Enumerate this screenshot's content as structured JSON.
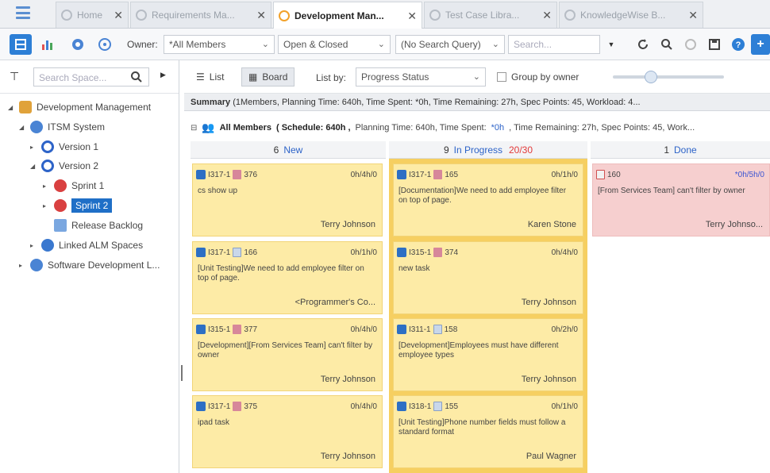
{
  "tabs": [
    {
      "label": "Home",
      "active": false
    },
    {
      "label": "Requirements Ma...",
      "active": false
    },
    {
      "label": "Development Man...",
      "active": true
    },
    {
      "label": "Test Case Libra...",
      "active": false
    },
    {
      "label": "KnowledgeWise B...",
      "active": false
    }
  ],
  "toolbar": {
    "owner_label": "Owner:",
    "owner_value": "*All Members",
    "status_value": "Open & Closed",
    "query_value": "(No Search Query)",
    "search_placeholder": "Search..."
  },
  "left": {
    "search_placeholder": "Search Space...",
    "tree": [
      {
        "label": "Development Management",
        "level": 0,
        "expanded": true,
        "icon": "db-icon",
        "color": "#e0a23a"
      },
      {
        "label": "ITSM System",
        "level": 1,
        "expanded": true,
        "icon": "project-icon",
        "color": "#4a84d4"
      },
      {
        "label": "Version 1",
        "level": 2,
        "expanded": false,
        "icon": "version-icon",
        "color": "#2d63c8"
      },
      {
        "label": "Version 2",
        "level": 2,
        "expanded": true,
        "icon": "version-icon",
        "color": "#2d63c8"
      },
      {
        "label": "Sprint 1",
        "level": 3,
        "expanded": false,
        "icon": "sprint-icon",
        "color": "#d94040"
      },
      {
        "label": "Sprint 2",
        "level": 3,
        "expanded": false,
        "icon": "sprint-icon",
        "color": "#d94040",
        "selected": true
      },
      {
        "label": "Release Backlog",
        "level": 2,
        "expanded": null,
        "icon": "backlog-icon",
        "color": "#7aa7e0"
      },
      {
        "label": "Linked ALM Spaces",
        "level": 1,
        "expanded": false,
        "icon": "link-icon",
        "color": "#3a78cf"
      },
      {
        "label": "Software Development L...",
        "level": 0,
        "expanded": false,
        "icon": "project-icon",
        "color": "#4a84d4"
      }
    ]
  },
  "view": {
    "list_label": "List",
    "board_label": "Board",
    "list_by_label": "List by:",
    "list_by_value": "Progress Status",
    "group_label": "Group by owner"
  },
  "summary": {
    "label": "Summary",
    "text": "(1Members, Planning Time: 640h, Time Spent: *0h, Time Remaining: 27h, Spec Points: 45, Workload: 4..."
  },
  "owner_row": {
    "name": "All Members",
    "schedule": "( Schedule: 640h ,",
    "rest_a": "Planning Time: 640h, Time Spent:",
    "spent": "*0h",
    "rest_b": ", Time Remaining: 27h, Spec Points: 45, Work..."
  },
  "columns": [
    {
      "count": "6",
      "name": "New",
      "wip": ""
    },
    {
      "count": "9",
      "name": "In Progress",
      "wip": "20/30"
    },
    {
      "count": "1",
      "name": "Done",
      "wip": ""
    }
  ],
  "cards": {
    "new": [
      {
        "id": "I317-1",
        "num": "376",
        "time": "0h/4h/0",
        "desc": "cs show up",
        "owner": "Terry Johnson"
      },
      {
        "id": "I317-1",
        "num": "166",
        "time": "0h/1h/0",
        "desc": "[Unit Testing]We need to add employee filter on top of page.",
        "owner": "<Programmer's Co..."
      },
      {
        "id": "I315-1",
        "num": "377",
        "time": "0h/4h/0",
        "desc": "[Development][From Services Team] can't filter by owner",
        "owner": "Terry Johnson"
      },
      {
        "id": "I317-1",
        "num": "375",
        "time": "0h/4h/0",
        "desc": "ipad task",
        "owner": "Terry Johnson"
      }
    ],
    "inprogress": [
      {
        "id": "I317-1",
        "num": "165",
        "time": "0h/1h/0",
        "desc": "[Documentation]We need to add employee filter on top of page.",
        "owner": "Karen Stone"
      },
      {
        "id": "I315-1",
        "num": "374",
        "time": "0h/4h/0",
        "desc": "new task",
        "owner": "Terry Johnson"
      },
      {
        "id": "I311-1",
        "num": "158",
        "time": "0h/2h/0",
        "desc": "[Development]Employees must have different employee types",
        "owner": "Terry Johnson"
      },
      {
        "id": "I318-1",
        "num": "155",
        "time": "0h/1h/0",
        "desc": "[Unit Testing]Phone number fields must follow a standard format",
        "owner": "Paul Wagner"
      }
    ],
    "done": [
      {
        "id": "",
        "num": "160",
        "time": "*0h/5h/0",
        "desc": "[From Services Team] can't filter by owner",
        "owner": "Terry Johnso..."
      }
    ]
  },
  "colors": {
    "accent": "#2d7fd6",
    "card_yellow": "#fdeba6",
    "card_pink": "#f6cfcf",
    "inprogress_border": "#f6cf61",
    "wip_red": "#e23a3a"
  }
}
